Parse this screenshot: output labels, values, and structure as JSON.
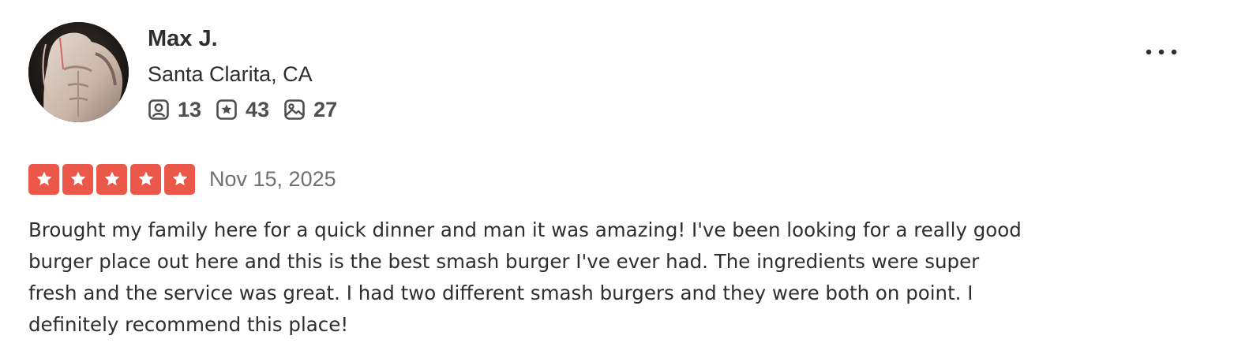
{
  "user": {
    "name": "Max J.",
    "location": "Santa Clarita, CA",
    "avatar_icon": "user-avatar-photo",
    "stats": [
      {
        "icon": "friends-icon",
        "value": "13"
      },
      {
        "icon": "reviews-star-icon",
        "value": "43"
      },
      {
        "icon": "photos-icon",
        "value": "27"
      }
    ]
  },
  "menu": {
    "icon": "more-options-icon",
    "label": "..."
  },
  "review": {
    "rating": 5,
    "max_rating": 5,
    "date": "Nov 15, 2025",
    "text": "Brought my family here for a quick dinner and man it was amazing! I've been looking for a really good burger place out here and this is the best smash burger I've ever had. The ingredients were super fresh and the service was great. I had two different smash burgers and they were both on point. I definitely recommend this place!"
  },
  "colors": {
    "star_fill": "#eb5749",
    "text_primary": "#2d2e2f",
    "text_secondary": "#6e7072"
  }
}
